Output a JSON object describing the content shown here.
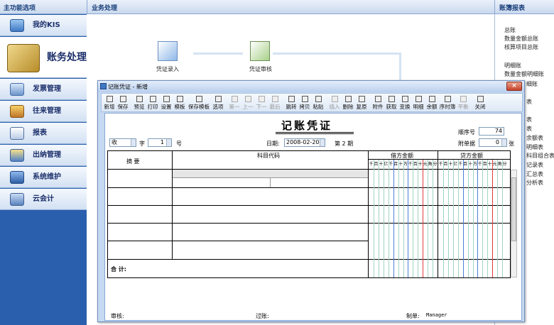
{
  "nav": {
    "title": "主功能选项",
    "items": [
      {
        "label": "我的KIS",
        "icon": "monitor-icon"
      },
      {
        "label": "账务处理",
        "icon": "calculator-icon"
      },
      {
        "label": "发票管理",
        "icon": "invoice-icon"
      },
      {
        "label": "往来管理",
        "icon": "transactions-icon"
      },
      {
        "label": "报表",
        "icon": "report-icon"
      },
      {
        "label": "出纳管理",
        "icon": "cashier-icon"
      },
      {
        "label": "系统维护",
        "icon": "maintenance-icon"
      },
      {
        "label": "云会计",
        "icon": "cloud-computer-icon"
      }
    ]
  },
  "main": {
    "title": "业务处理",
    "flow": [
      {
        "label": "凭证录入",
        "icon": "voucher-entry-icon"
      },
      {
        "label": "凭证审核",
        "icon": "voucher-audit-icon"
      }
    ]
  },
  "right_panel": {
    "title": "账簿报表",
    "links": [
      "总账",
      "数量金额总账",
      "核算项目总账",
      "明细账",
      "数量金额明细账",
      "细账"
    ],
    "partial_links": [
      "表",
      "表",
      "表",
      "余额表",
      "明细表",
      "科目组合表",
      "记录表",
      "汇总表",
      "分析表"
    ]
  },
  "dialog": {
    "title": "记账凭证 - 新增",
    "close": "×",
    "toolbar": [
      {
        "label": "新增",
        "enabled": true
      },
      {
        "label": "保存",
        "enabled": true
      },
      {
        "label": "预览",
        "enabled": true
      },
      {
        "label": "打印",
        "enabled": true
      },
      {
        "label": "设置",
        "enabled": true
      },
      {
        "label": "模板",
        "enabled": true
      },
      {
        "label": "保存模板",
        "enabled": true
      },
      {
        "label": "选项",
        "enabled": true
      },
      {
        "label": "第一",
        "enabled": false
      },
      {
        "label": "上一",
        "enabled": false
      },
      {
        "label": "下一",
        "enabled": false
      },
      {
        "label": "最后",
        "enabled": false
      },
      {
        "label": "跳转",
        "enabled": true
      },
      {
        "label": "拷贝",
        "enabled": true
      },
      {
        "label": "粘贴",
        "enabled": true
      },
      {
        "label": "插入",
        "enabled": false
      },
      {
        "label": "删除",
        "enabled": true
      },
      {
        "label": "复原",
        "enabled": true
      },
      {
        "label": "附件",
        "enabled": true
      },
      {
        "label": "获取",
        "enabled": true
      },
      {
        "label": "变换",
        "enabled": true
      },
      {
        "label": "明细",
        "enabled": true
      },
      {
        "label": "余额",
        "enabled": true
      },
      {
        "label": "序时簿",
        "enabled": true
      },
      {
        "label": "平衡",
        "enabled": false
      },
      {
        "label": "关闭",
        "enabled": true
      }
    ],
    "voucher": {
      "heading": "记账凭证",
      "seq_label": "顺序号",
      "seq_value": "74",
      "attach_label": "附单据",
      "attach_value": "0",
      "attach_unit": "张",
      "word_value": "收",
      "word_label": "字",
      "number_value": "1",
      "number_label": "号",
      "date_label": "日期:",
      "date_value": "2008-02-20",
      "period_label": "第 2 期",
      "col_summary": "摘    要",
      "col_account": "科目代码",
      "col_debit": "借方金额",
      "col_credit": "贷方金额",
      "digit_units": [
        "千",
        "百",
        "十",
        "亿",
        "千",
        "百",
        "十",
        "万",
        "千",
        "百",
        "十",
        "元",
        "角",
        "分"
      ],
      "total_label": "合  计:",
      "audit_label": "审核:",
      "post_label": "过账:",
      "maker_label": "制单:",
      "maker_value": "Manager"
    }
  }
}
